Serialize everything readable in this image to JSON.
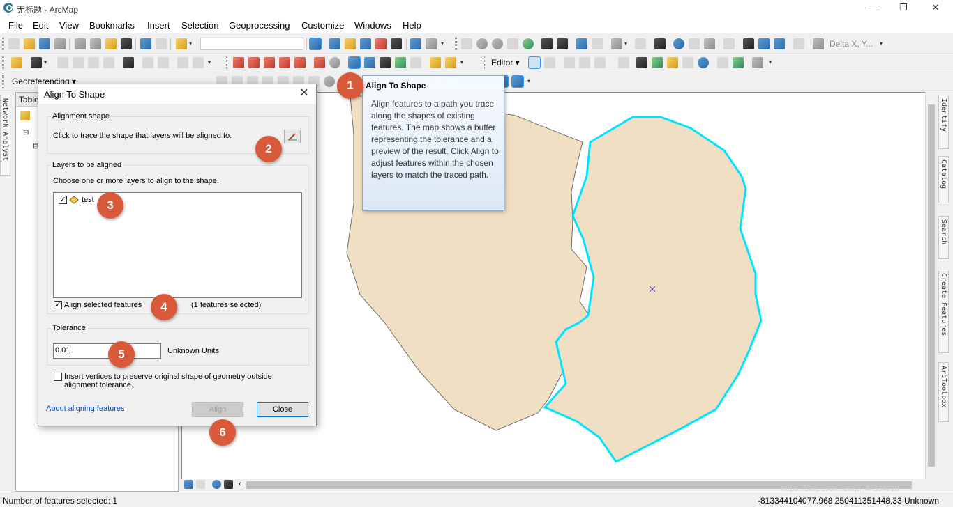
{
  "window": {
    "title": "无标题 - ArcMap",
    "minimize": "—",
    "restore": "❐",
    "close": "✕"
  },
  "menu": [
    "File",
    "Edit",
    "View",
    "Bookmarks",
    "Insert",
    "Selection",
    "Geoprocessing",
    "Customize",
    "Windows",
    "Help"
  ],
  "toolbar": {
    "delta_label": "Delta X, Y...",
    "editor_label": "Editor ▾",
    "georef_label": "Georeferencing ▾"
  },
  "toc": {
    "tab_label": "Table"
  },
  "side_tabs": {
    "left": "Network Analyst",
    "right": [
      "Identify",
      "Catalog",
      "Search",
      "Create Features",
      "ArcToolbox"
    ]
  },
  "dialog": {
    "title": "Align To Shape",
    "alignment_group": "Alignment shape",
    "alignment_desc": "Click to trace the shape that layers will be aligned to.",
    "layers_group": "Layers to be aligned",
    "layers_desc": "Choose one or more layers to align to the shape.",
    "layers": [
      {
        "name": "test",
        "checked": true
      }
    ],
    "align_selected_label": "Align selected features",
    "features_selected": "(1 features selected)",
    "tolerance_group": "Tolerance",
    "tolerance_value": "0.01",
    "tolerance_units": "Unknown Units",
    "insert_vertices_label": "Insert vertices to preserve original shape of geometry outside alignment tolerance.",
    "about_link": "About aligning features",
    "align_button": "Align",
    "close_button": "Close"
  },
  "tooltip": {
    "title": "Align To Shape",
    "body": "Align features to a path you trace along the shapes of existing features. The map shows a buffer representing the tolerance and a preview of the result. Click Align to adjust features within the chosen layers to match the traced path."
  },
  "badges": [
    "1",
    "2",
    "3",
    "4",
    "5",
    "6"
  ],
  "status": {
    "features_selected": "Number of features selected: 1",
    "coordinates": "-813344104077.968  250411351448.33 Unknown",
    "watermark": "https://blog.csdn.net/qq_44534716"
  },
  "colors": {
    "polygon_fill": "#f1dfc4",
    "polygon_outline": "#6e6e6e",
    "selection_outline": "#00e5ff",
    "badge": "#d9593b"
  }
}
